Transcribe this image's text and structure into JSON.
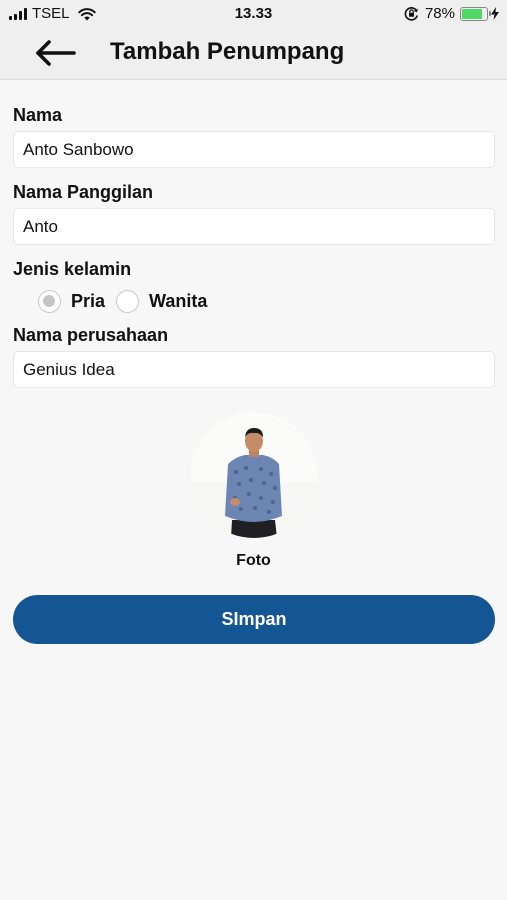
{
  "status_bar": {
    "carrier": "TSEL",
    "time": "13.33",
    "battery_percent": "78%",
    "battery_level": 0.78,
    "signal_bars": 4,
    "icons": [
      "signal-icon",
      "wifi-icon",
      "rotation-lock-icon",
      "battery-icon",
      "charging-bolt-icon"
    ]
  },
  "header": {
    "back_icon": "arrow-left-icon",
    "title": "Tambah Penumpang"
  },
  "form": {
    "name": {
      "label": "Nama",
      "value": "Anto Sanbowo"
    },
    "nickname": {
      "label": "Nama Panggilan",
      "value": "Anto"
    },
    "gender": {
      "label": "Jenis kelamin",
      "options": [
        {
          "label": "Pria",
          "selected": true
        },
        {
          "label": "Wanita",
          "selected": false
        }
      ]
    },
    "company": {
      "label": "Nama perusahaan",
      "value": "Genius Idea"
    },
    "photo": {
      "caption": "Foto"
    },
    "save_label": "SImpan"
  },
  "colors": {
    "accent": "#145594",
    "background": "#f7f7f7",
    "header_background": "#efefef",
    "battery_green": "#4cd964"
  }
}
